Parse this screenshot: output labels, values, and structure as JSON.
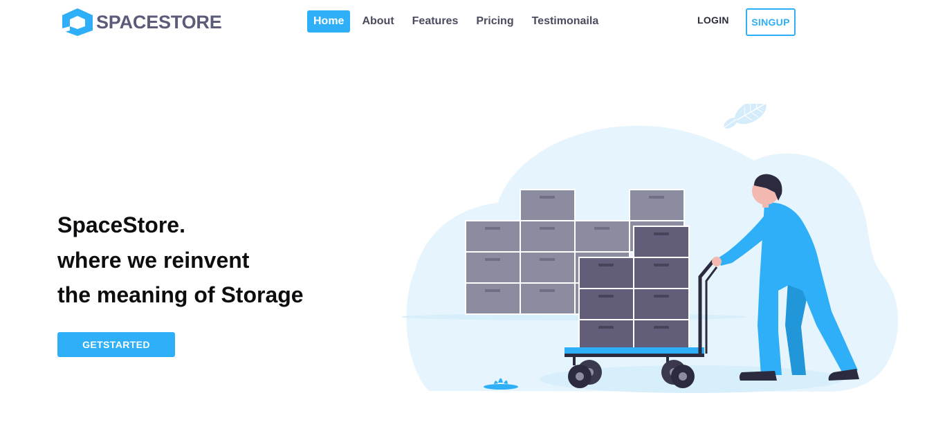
{
  "brand": {
    "name": "SPACESTORE",
    "logo_icon": "hexagon-box-logo-icon"
  },
  "nav": {
    "items": [
      {
        "label": "Home",
        "active": true
      },
      {
        "label": "About",
        "active": false
      },
      {
        "label": "Features",
        "active": false
      },
      {
        "label": "Pricing",
        "active": false
      },
      {
        "label": "Testimonaila",
        "active": false
      }
    ],
    "login_label": "LOGIN",
    "signup_label": "SINGUP"
  },
  "hero": {
    "lines": [
      "SpaceStore.",
      "where we reinvent",
      "the meaning of Storage"
    ],
    "cta_label": "GETSTARTED",
    "illustration": "person-pushing-cart-of-boxes-illustration"
  },
  "colors": {
    "accent": "#2eaff8",
    "brand_text": "#5a5c7a",
    "nav_text": "#4a4b5e",
    "heading": "#0d0d10",
    "blob": "#e6f5fd",
    "box_light": "#8b8c9f",
    "box_dark": "#625d79"
  }
}
